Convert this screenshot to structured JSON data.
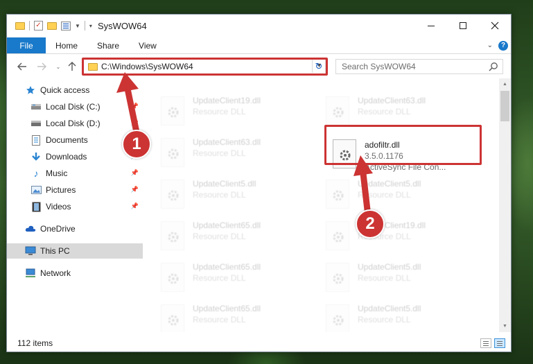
{
  "window": {
    "title": "SysWOW64"
  },
  "ribbon": {
    "file_tab": "File",
    "tabs": [
      "Home",
      "Share",
      "View"
    ]
  },
  "address_bar": {
    "path": "C:\\Windows\\SysWOW64",
    "search_placeholder": "Search SysWOW64"
  },
  "sidebar": {
    "items": [
      {
        "label": "Quick access",
        "icon": "star-icon"
      },
      {
        "label": "Local Disk (C:)",
        "icon": "drive-icon",
        "pinned": true
      },
      {
        "label": "Local Disk (D:)",
        "icon": "drive-icon",
        "pinned": true
      },
      {
        "label": "Documents",
        "icon": "document-icon",
        "pinned": true
      },
      {
        "label": "Downloads",
        "icon": "download-icon",
        "pinned": true
      },
      {
        "label": "Music",
        "icon": "music-icon",
        "pinned": true
      },
      {
        "label": "Pictures",
        "icon": "picture-icon",
        "pinned": true
      },
      {
        "label": "Videos",
        "icon": "video-icon",
        "pinned": true
      },
      {
        "label": "OneDrive",
        "icon": "cloud-icon"
      },
      {
        "label": "This PC",
        "icon": "computer-icon",
        "selected": true
      },
      {
        "label": "Network",
        "icon": "network-icon"
      }
    ]
  },
  "files": {
    "left_column": [
      {
        "name": "UpdateClient19.dll",
        "type": "Resource DLL"
      },
      {
        "name": "UpdateClient63.dll",
        "type": "Resource DLL"
      },
      {
        "name": "UpdateClient5.dll",
        "type": "Resource DLL"
      },
      {
        "name": "UpdateClient65.dll",
        "type": "Resource DLL"
      },
      {
        "name": "UpdateClient65.dll",
        "type": "Resource DLL"
      },
      {
        "name": "UpdateClient65.dll",
        "type": "Resource DLL"
      }
    ],
    "right_column": [
      {
        "name": "UpdateClient63.dll",
        "type": "Resource DLL"
      },
      {
        "name": "adofiltr.dll",
        "version": "3.5.0.1176",
        "type": "ActiveSync File Con...",
        "highlighted": true
      },
      {
        "name": "UpdateClient5.dll",
        "type": "Resource DLL"
      },
      {
        "name": "UpdateClient19.dll",
        "type": "Resource DLL"
      },
      {
        "name": "UpdateClient5.dll",
        "type": "Resource DLL"
      },
      {
        "name": "UpdateClient5.dll",
        "type": "Resource DLL"
      }
    ]
  },
  "annotations": {
    "step1": "1",
    "step2": "2",
    "color": "#cc3333"
  },
  "status_bar": {
    "item_count": "112 items"
  },
  "colors": {
    "accent": "#1979ca",
    "selected_bg": "#d9d9d9"
  }
}
